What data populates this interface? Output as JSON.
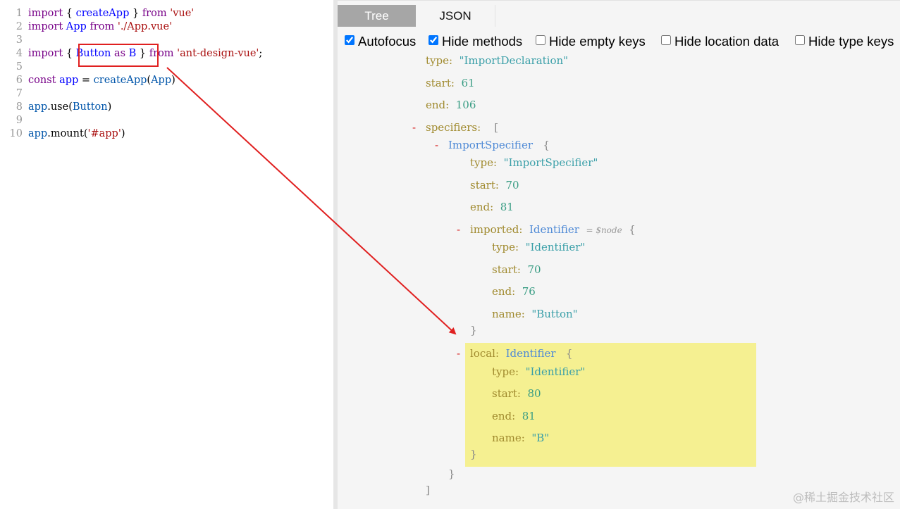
{
  "editor": {
    "lines": [
      {
        "n": "1",
        "t": [
          [
            "kw",
            "import"
          ],
          [
            "txt",
            " { "
          ],
          [
            "def",
            "createApp"
          ],
          [
            "txt",
            " } "
          ],
          [
            "kw",
            "from"
          ],
          [
            "txt",
            " "
          ],
          [
            "str",
            "'vue'"
          ]
        ]
      },
      {
        "n": "2",
        "t": [
          [
            "kw",
            "import"
          ],
          [
            "txt",
            " "
          ],
          [
            "def",
            "App"
          ],
          [
            "txt",
            " "
          ],
          [
            "kw",
            "from"
          ],
          [
            "txt",
            " "
          ],
          [
            "str",
            "'./App.vue'"
          ]
        ]
      },
      {
        "n": "3",
        "t": []
      },
      {
        "n": "4",
        "t": [
          [
            "kw",
            "import"
          ],
          [
            "txt",
            " { "
          ],
          [
            "def",
            "Button"
          ],
          [
            "txt",
            " "
          ],
          [
            "kw",
            "as"
          ],
          [
            "txt",
            " "
          ],
          [
            "def",
            "B"
          ],
          [
            "txt",
            " } "
          ],
          [
            "kw",
            "from"
          ],
          [
            "txt",
            " "
          ],
          [
            "str",
            "'ant-design-vue'"
          ],
          [
            "txt",
            ";"
          ]
        ]
      },
      {
        "n": "5",
        "t": []
      },
      {
        "n": "6",
        "t": [
          [
            "kw",
            "const"
          ],
          [
            "txt",
            " "
          ],
          [
            "def",
            "app"
          ],
          [
            "txt",
            " = "
          ],
          [
            "var",
            "createApp"
          ],
          [
            "txt",
            "("
          ],
          [
            "var",
            "App"
          ],
          [
            "txt",
            ")"
          ]
        ]
      },
      {
        "n": "7",
        "t": []
      },
      {
        "n": "8",
        "t": [
          [
            "var",
            "app"
          ],
          [
            "txt",
            "."
          ],
          [
            "txt",
            "use"
          ],
          [
            "txt",
            "("
          ],
          [
            "var",
            "Button"
          ],
          [
            "txt",
            ")"
          ]
        ]
      },
      {
        "n": "9",
        "t": []
      },
      {
        "n": "10",
        "t": [
          [
            "var",
            "app"
          ],
          [
            "txt",
            "."
          ],
          [
            "txt",
            "mount"
          ],
          [
            "txt",
            "("
          ],
          [
            "str",
            "'#app'"
          ],
          [
            "txt",
            ")"
          ]
        ]
      }
    ]
  },
  "tabs": {
    "tree": "Tree",
    "json": "JSON"
  },
  "options": [
    {
      "label": "Autofocus",
      "checked": true
    },
    {
      "label": "Hide methods",
      "checked": true
    },
    {
      "label": "Hide empty keys",
      "checked": false
    },
    {
      "label": "Hide location data",
      "checked": false
    },
    {
      "label": "Hide type keys",
      "checked": false
    }
  ],
  "tree": {
    "toggle": "-",
    "sep": ":",
    "import_decl": {
      "type_key": "type",
      "type_val": "\"ImportDeclaration\"",
      "start_key": "start",
      "start_val": "61",
      "end_key": "end",
      "end_val": "106"
    },
    "specifiers": {
      "key": "specifiers",
      "open": "[",
      "close": "]"
    },
    "import_specifier": {
      "name": "ImportSpecifier",
      "open": "{",
      "close": "}",
      "type_key": "type",
      "type_val": "\"ImportSpecifier\"",
      "start_key": "start",
      "start_val": "70",
      "end_key": "end",
      "end_val": "81"
    },
    "imported": {
      "key": "imported",
      "name": "Identifier",
      "node_hint": "= $node",
      "open": "{",
      "close": "}",
      "type_key": "type",
      "type_val": "\"Identifier\"",
      "start_key": "start",
      "start_val": "70",
      "end_key": "end",
      "end_val": "76",
      "name_key": "name",
      "name_val": "\"Button\""
    },
    "local": {
      "key": "local",
      "name": "Identifier",
      "open": "{",
      "close": "}",
      "type_key": "type",
      "type_val": "\"Identifier\"",
      "start_key": "start",
      "start_val": "80",
      "end_key": "end",
      "end_val": "81",
      "name_key": "name",
      "name_val": "\"B\""
    }
  },
  "watermark": "@稀土掘金技术社区",
  "colors": {
    "arrow": "#e02020",
    "highlight": "#f5f091",
    "active_tab": "#a6a6a6"
  }
}
